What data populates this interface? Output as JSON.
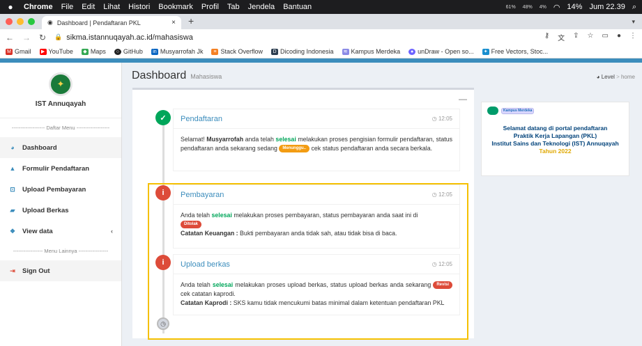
{
  "macbar": {
    "app": "Chrome",
    "menus": [
      "File",
      "Edit",
      "Lihat",
      "Histori",
      "Bookmark",
      "Profil",
      "Tab",
      "Jendela",
      "Bantuan"
    ],
    "cpu": "61%",
    "mem": "48%",
    "disk": "4%",
    "battery": "14%",
    "clock": "Jum 22.39"
  },
  "browser": {
    "tab_title": "Dashboard | Pendaftaran PKL",
    "url": "sikma.istannuqayah.ac.id/mahasiswa",
    "bookmarks": [
      "Gmail",
      "YouTube",
      "Maps",
      "GitHub",
      "Musyarrofah Jk",
      "Stack Overflow",
      "Dicoding Indonesia",
      "Kampus Merdeka",
      "unDraw - Open so...",
      "Free Vectors, Stoc..."
    ]
  },
  "sidebar": {
    "brand": "IST Annuqayah",
    "header_main": "------------------- Daftar Menu -------------------",
    "items": [
      {
        "label": "Dashboard",
        "icon": "dashboard-icon"
      },
      {
        "label": "Formulir Pendaftaran",
        "icon": "user-icon"
      },
      {
        "label": "Upload Pembayaran",
        "icon": "upload-icon"
      },
      {
        "label": "Upload Berkas",
        "icon": "file-icon"
      },
      {
        "label": "View data",
        "icon": "users-icon"
      }
    ],
    "header_other": "----------------- Menu Lainnya -----------------",
    "signout": "Sign Out"
  },
  "page": {
    "title": "Dashboard",
    "subtitle": "Mahasiswa",
    "crumb_level": "Level",
    "crumb_home": "home"
  },
  "timeline": [
    {
      "title": "Pendaftaran",
      "time": "12:05",
      "status": "success",
      "p1": "Selamat! ",
      "name": "Musyarrofah",
      "p2": " anda telah ",
      "hl": "selesai",
      "p3": " melakukan proses pengisian formulir pendaftaran, status pendaftaran anda sekarang sedang ",
      "tag": "Menunggu..",
      "p4": " cek status pendaftaran anda secara berkala."
    },
    {
      "title": "Pembayaran",
      "time": "12:05",
      "status": "danger",
      "p1": "Anda telah ",
      "hl": "selesai",
      "p2": " melakukan proses pembayaran, status pembayaran anda saat ini di ",
      "tag": "Ditolak",
      "note_label": "Catatan Keuangan :",
      "note": " Bukti pembayaran anda tidak sah, atau tidak bisa di baca."
    },
    {
      "title": "Upload berkas",
      "time": "12:05",
      "status": "danger",
      "p1": "Anda telah ",
      "hl": "selesai",
      "p2": " melakukan proses upload berkas, status upload berkas anda sekarang ",
      "tag": "Revisi",
      "p3": " cek catatan kaprodi.",
      "note_label": "Catatan Kaprodi :",
      "note": " SKS kamu tidak mencukumi batas minimal dalam ketentuan pendaftaran PKL"
    }
  ],
  "banner": {
    "km_logo": "Kampus Merdeka",
    "line1": "Selamat datang di portal pendaftaran",
    "line2": "Praktik Kerja Lapangan (PKL)",
    "line3": "Institut Sains dan Teknologi (IST) Annuqayah",
    "line4": "Tahun 2022"
  },
  "colors": {
    "primary": "#3c8dbc",
    "success": "#00a65a",
    "danger": "#dd4b39",
    "warning": "#f39c12",
    "highlight": "#f5c000"
  }
}
